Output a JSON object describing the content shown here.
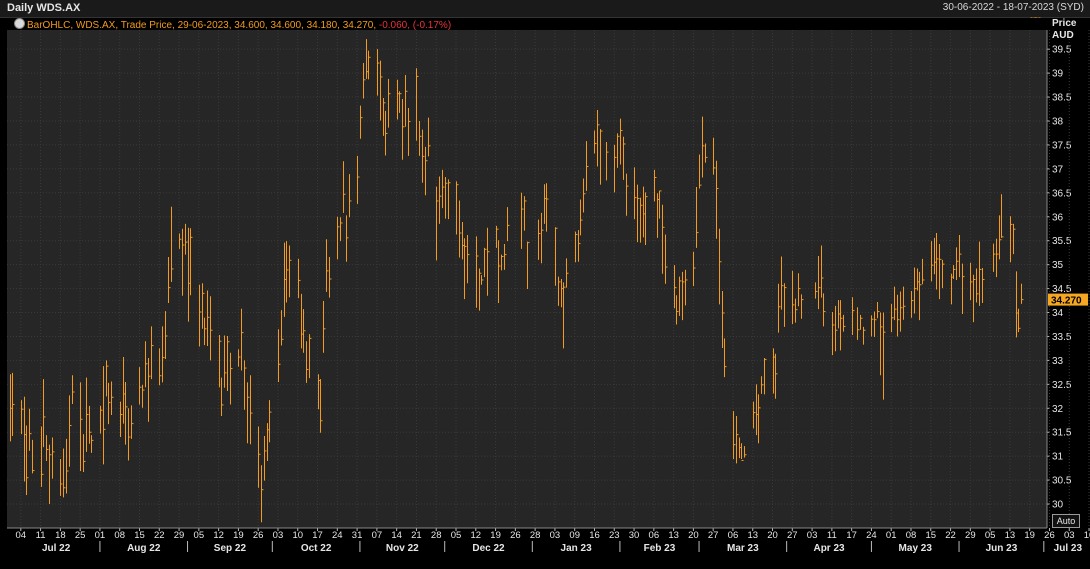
{
  "header": {
    "title": "Daily WDS.AX",
    "date_range": "30-06-2022 - 18-07-2023 (SYD)"
  },
  "legend": {
    "series": "BarOHLC, WDS.AX, Trade Price, 29-06-2023, 34.600, 34.600, 34.180, 34.270,",
    "change": "-0.060, (-0.17%)"
  },
  "axis_header": {
    "line1": "Price",
    "line2": "AUD"
  },
  "auto_button": {
    "label": "Auto"
  },
  "last_price": {
    "label": "34.270",
    "value": 34.27
  },
  "colors": {
    "background": "#262626",
    "bar": "#f29b1f",
    "change_negative": "#e8333a",
    "last_price_tag": "#f5a623"
  },
  "chart_data": {
    "type": "ohlc",
    "ylim": [
      29.5,
      39.9
    ],
    "yticks": [
      30,
      30.5,
      31,
      31.5,
      32,
      32.5,
      33,
      33.5,
      34,
      34.5,
      35,
      35.5,
      36,
      36.5,
      37,
      37.5,
      38,
      38.5,
      39,
      39.5
    ],
    "x_day_labels": [
      "04",
      "11",
      "18",
      "25",
      "01",
      "08",
      "15",
      "22",
      "29",
      "05",
      "12",
      "19",
      "26",
      "03",
      "10",
      "17",
      "24",
      "31",
      "07",
      "14",
      "21",
      "28",
      "05",
      "12",
      "19",
      "26",
      "28",
      "03",
      "09",
      "16",
      "23",
      "30",
      "06",
      "13",
      "20",
      "27",
      "06",
      "13",
      "20",
      "27",
      "03",
      "11",
      "17",
      "24",
      "01",
      "08",
      "15",
      "22",
      "29",
      "05",
      "13",
      "19",
      "26",
      "03",
      "10",
      "17"
    ],
    "x_month_labels": [
      "Jul 22",
      "Aug 22",
      "Sep 22",
      "Oct 22",
      "Nov 22",
      "Dec 22",
      "Jan 23",
      "Feb 23",
      "Mar 23",
      "Apr 23",
      "May 23",
      "Jun 23",
      "Jul 23"
    ],
    "x": [
      "2022-06-30",
      "2022-07-01",
      "2022-07-04",
      "2022-07-05",
      "2022-07-06",
      "2022-07-07",
      "2022-07-08",
      "2022-07-11",
      "2022-07-12",
      "2022-07-13",
      "2022-07-14",
      "2022-07-15",
      "2022-07-18",
      "2022-07-19",
      "2022-07-20",
      "2022-07-21",
      "2022-07-22",
      "2022-07-25",
      "2022-07-26",
      "2022-07-27",
      "2022-07-28",
      "2022-07-29",
      "2022-08-01",
      "2022-08-02",
      "2022-08-03",
      "2022-08-04",
      "2022-08-05",
      "2022-08-08",
      "2022-08-09",
      "2022-08-10",
      "2022-08-11",
      "2022-08-12",
      "2022-08-15",
      "2022-08-16",
      "2022-08-17",
      "2022-08-18",
      "2022-08-19",
      "2022-08-22",
      "2022-08-23",
      "2022-08-24",
      "2022-08-25",
      "2022-08-26",
      "2022-08-29",
      "2022-08-30",
      "2022-08-31",
      "2022-09-01",
      "2022-09-02",
      "2022-09-05",
      "2022-09-06",
      "2022-09-07",
      "2022-09-08",
      "2022-09-09",
      "2022-09-12",
      "2022-09-13",
      "2022-09-14",
      "2022-09-15",
      "2022-09-16",
      "2022-09-19",
      "2022-09-20",
      "2022-09-21",
      "2022-09-22",
      "2022-09-23",
      "2022-09-26",
      "2022-09-27",
      "2022-09-28",
      "2022-09-29",
      "2022-09-30",
      "2022-10-03",
      "2022-10-04",
      "2022-10-05",
      "2022-10-06",
      "2022-10-07",
      "2022-10-10",
      "2022-10-11",
      "2022-10-12",
      "2022-10-13",
      "2022-10-14",
      "2022-10-17",
      "2022-10-18",
      "2022-10-19",
      "2022-10-20",
      "2022-10-21",
      "2022-10-24",
      "2022-10-25",
      "2022-10-26",
      "2022-10-27",
      "2022-10-28",
      "2022-10-31",
      "2022-11-01",
      "2022-11-02",
      "2022-11-03",
      "2022-11-04",
      "2022-11-07",
      "2022-11-08",
      "2022-11-09",
      "2022-11-10",
      "2022-11-11",
      "2022-11-14",
      "2022-11-15",
      "2022-11-16",
      "2022-11-17",
      "2022-11-18",
      "2022-11-21",
      "2022-11-22",
      "2022-11-23",
      "2022-11-24",
      "2022-11-25",
      "2022-11-28",
      "2022-11-29",
      "2022-11-30",
      "2022-12-01",
      "2022-12-02",
      "2022-12-05",
      "2022-12-06",
      "2022-12-07",
      "2022-12-08",
      "2022-12-09",
      "2022-12-12",
      "2022-12-13",
      "2022-12-14",
      "2022-12-15",
      "2022-12-16",
      "2022-12-19",
      "2022-12-20",
      "2022-12-21",
      "2022-12-22",
      "2022-12-23",
      "2022-12-28",
      "2022-12-29",
      "2022-12-30",
      "2023-01-03",
      "2023-01-04",
      "2023-01-05",
      "2023-01-06",
      "2023-01-09",
      "2023-01-10",
      "2023-01-11",
      "2023-01-12",
      "2023-01-13",
      "2023-01-16",
      "2023-01-17",
      "2023-01-18",
      "2023-01-19",
      "2023-01-20",
      "2023-01-23",
      "2023-01-24",
      "2023-01-25",
      "2023-01-27",
      "2023-01-30",
      "2023-01-31",
      "2023-02-01",
      "2023-02-02",
      "2023-02-03",
      "2023-02-06",
      "2023-02-07",
      "2023-02-08",
      "2023-02-09",
      "2023-02-10",
      "2023-02-13",
      "2023-02-14",
      "2023-02-15",
      "2023-02-16",
      "2023-02-17",
      "2023-02-20",
      "2023-02-21",
      "2023-02-22",
      "2023-02-23",
      "2023-02-24",
      "2023-02-27",
      "2023-02-28",
      "2023-03-01",
      "2023-03-02",
      "2023-03-03",
      "2023-03-06",
      "2023-03-07",
      "2023-03-08",
      "2023-03-09",
      "2023-03-10",
      "2023-03-13",
      "2023-03-14",
      "2023-03-15",
      "2023-03-16",
      "2023-03-17",
      "2023-03-20",
      "2023-03-21",
      "2023-03-22",
      "2023-03-23",
      "2023-03-24",
      "2023-03-27",
      "2023-03-28",
      "2023-03-29",
      "2023-03-30",
      "2023-03-31",
      "2023-04-03",
      "2023-04-04",
      "2023-04-05",
      "2023-04-06",
      "2023-04-11",
      "2023-04-12",
      "2023-04-13",
      "2023-04-14",
      "2023-04-17",
      "2023-04-18",
      "2023-04-19",
      "2023-04-20",
      "2023-04-21",
      "2023-04-24",
      "2023-04-26",
      "2023-04-27",
      "2023-04-28",
      "2023-05-01",
      "2023-05-02",
      "2023-05-03",
      "2023-05-04",
      "2023-05-05",
      "2023-05-08",
      "2023-05-09",
      "2023-05-10",
      "2023-05-11",
      "2023-05-12",
      "2023-05-15",
      "2023-05-16",
      "2023-05-17",
      "2023-05-18",
      "2023-05-19",
      "2023-05-22",
      "2023-05-23",
      "2023-05-24",
      "2023-05-25",
      "2023-05-26",
      "2023-05-29",
      "2023-05-30",
      "2023-05-31",
      "2023-06-01",
      "2023-06-02",
      "2023-06-05",
      "2023-06-06",
      "2023-06-07",
      "2023-06-08",
      "2023-06-09",
      "2023-06-13",
      "2023-06-14",
      "2023-06-15",
      "2023-06-16",
      "2023-06-19",
      "2023-06-20",
      "2023-06-21",
      "2023-06-22",
      "2023-06-23",
      "2023-06-26",
      "2023-06-27",
      "2023-06-28",
      "2023-06-29"
    ],
    "close": [
      32.0,
      32.08,
      31.98,
      31.45,
      30.55,
      31.47,
      30.7,
      30.62,
      31.82,
      31.14,
      31.03,
      31.09,
      30.42,
      30.34,
      30.69,
      31.64,
      32.34,
      31.77,
      30.89,
      31.87,
      31.5,
      31.33,
      31.96,
      31.56,
      32.88,
      32.12,
      32.23,
      31.87,
      32.3,
      32.03,
      31.4,
      31.68,
      32.44,
      32.38,
      32.93,
      32.67,
      33.31,
      32.68,
      33.06,
      33.51,
      34.52,
      34.91,
      35.53,
      35.41,
      35.47,
      34.61,
      35.57,
      34.01,
      34.4,
      33.66,
      33.9,
      33.63,
      33.4,
      32.07,
      32.74,
      33.39,
      32.83,
      33.07,
      33.58,
      32.84,
      32.23,
      31.9,
      31.04,
      30.3,
      31.11,
      31.55,
      31.92,
      32.92,
      33.44,
      34.69,
      34.89,
      35.09,
      34.67,
      33.55,
      33.62,
      32.81,
      33.46,
      32.58,
      31.74,
      33.66,
      34.87,
      34.7,
      35.79,
      35.87,
      36.47,
      35.56,
      36.33,
      36.83,
      38.07,
      38.86,
      39.03,
      39.33,
      39.21,
      38.92,
      38.38,
      37.74,
      38.57,
      38.57,
      38.57,
      37.88,
      38.62,
      37.99,
      38.93,
      37.68,
      37.26,
      37.17,
      37.48,
      36.33,
      36.43,
      36.62,
      36.7,
      36.71,
      36.67,
      35.66,
      35.4,
      35.38,
      35.21,
      35.18,
      34.82,
      34.68,
      35.32,
      35.27,
      35.74,
      34.97,
      35.17,
      35.21,
      35.82,
      36.16,
      36.33,
      35.46,
      35.65,
      35.72,
      36.38,
      36.37,
      35.76,
      34.64,
      34.5,
      34.53,
      34.82,
      35.63,
      35.44,
      35.93,
      36.48,
      37.05,
      37.53,
      37.92,
      37.79,
      37.35,
      37.24,
      37.68,
      37.8,
      37.52,
      36.64,
      36.4,
      36.38,
      36.24,
      36.06,
      36.42,
      36.82,
      36.36,
      36.54,
      35.78,
      34.95,
      34.52,
      34.02,
      34.66,
      34.64,
      34.68,
      34.93,
      35.67,
      36.66,
      37.48,
      37.24,
      37.02,
      36.59,
      35.06,
      33.99,
      32.87,
      31.24,
      31.45,
      31.18,
      30.91,
      31.03,
      31.91,
      31.87,
      32.01,
      32.49,
      33.02,
      33.07,
      32.72,
      34.12,
      34.56,
      34.52,
      34.16,
      34.06,
      34.5,
      34.27,
      34.44,
      34.52,
      34.72,
      34.02,
      33.74,
      33.63,
      33.97,
      33.88,
      33.71,
      34.04,
      33.64,
      33.88,
      33.63,
      33.86,
      33.85,
      34.02,
      33.7,
      33.59,
      33.89,
      34.07,
      33.85,
      34.1,
      34.13,
      34.25,
      34.5,
      34.64,
      34.58,
      34.68,
      34.99,
      35.05,
      35.12,
      35.11,
      35.01,
      34.74,
      34.9,
      35.07,
      35.22,
      34.75,
      34.64,
      34.69,
      34.39,
      34.9,
      34.69,
      35.22,
      35.22,
      35.52,
      35.58,
      35.84,
      35.74,
      33.99,
      33.67,
      34.27
    ],
    "high": [
      32.71,
      32.74,
      32.17,
      32.24,
      31.64,
      31.99,
      31.34,
      31.62,
      32.61,
      31.44,
      31.24,
      31.39,
      30.94,
      31.16,
      31.36,
      32.27,
      32.69,
      32.54,
      31.46,
      32.64,
      32.05,
      31.44,
      32.05,
      32.88,
      33.0,
      32.53,
      32.56,
      32.14,
      33.07,
      32.55,
      32.0,
      32.06,
      32.86,
      32.49,
      33.4,
      33.05,
      33.71,
      33.25,
      33.71,
      34.03,
      35.16,
      36.21,
      35.65,
      35.75,
      35.85,
      35.77,
      35.76,
      34.58,
      34.61,
      33.89,
      34.46,
      34.34,
      33.53,
      32.64,
      33.52,
      33.51,
      33.16,
      33.23,
      34.08,
      33.0,
      32.54,
      32.69,
      31.62,
      30.81,
      31.42,
      31.69,
      32.17,
      33.65,
      34.05,
      35.46,
      35.49,
      35.4,
      35.12,
      34.39,
      34.07,
      33.4,
      33.55,
      32.71,
      32.61,
      34.24,
      35.53,
      35.16,
      36.0,
      35.99,
      37.16,
      36.03,
      36.89,
      37.27,
      38.32,
      39.21,
      39.71,
      39.47,
      39.5,
      39.26,
      38.48,
      38.21,
      38.88,
      38.86,
      38.62,
      38.46,
      38.96,
      38.27,
      39.1,
      38.0,
      37.82,
      37.46,
      38.07,
      36.63,
      36.84,
      36.98,
      36.83,
      36.78,
      36.74,
      36.34,
      35.89,
      35.55,
      35.62,
      35.59,
      34.92,
      34.78,
      35.35,
      35.77,
      35.81,
      35.51,
      35.21,
      35.43,
      36.2,
      36.5,
      36.43,
      35.48,
      35.94,
      36.08,
      36.68,
      36.7,
      35.78,
      34.75,
      34.7,
      34.63,
      35.13,
      35.69,
      35.72,
      36.36,
      36.8,
      37.58,
      37.8,
      38.23,
      37.83,
      37.56,
      37.5,
      37.74,
      38.05,
      37.67,
      36.9,
      37.03,
      36.67,
      36.4,
      36.63,
      36.51,
      36.98,
      36.49,
      36.54,
      36.25,
      35.63,
      34.99,
      34.36,
      34.75,
      34.85,
      34.89,
      35.27,
      36.62,
      37.3,
      38.09,
      37.53,
      37.65,
      37.17,
      35.75,
      34.45,
      33.46,
      31.94,
      31.84,
      31.39,
      31.27,
      31.21,
      32.14,
      32.5,
      32.29,
      32.67,
      33.05,
      33.25,
      33.14,
      34.6,
      35.17,
      34.61,
      34.87,
      34.29,
      34.82,
      34.38,
      34.63,
      35.18,
      35.4,
      34.4,
      34.01,
      34.14,
      34.26,
      34.26,
      33.95,
      34.32,
      34.11,
      33.95,
      33.7,
      33.94,
      34.02,
      34.22,
      34.0,
      34.0,
      34.18,
      34.54,
      34.37,
      34.44,
      34.54,
      34.45,
      34.94,
      34.92,
      34.85,
      35.12,
      35.49,
      35.56,
      35.66,
      35.43,
      35.1,
      34.81,
      34.99,
      35.36,
      35.62,
      35.02,
      35.04,
      34.79,
      34.92,
      35.48,
      34.93,
      35.44,
      35.54,
      36.03,
      36.47,
      36.01,
      35.85,
      34.86,
      34.08,
      34.6
    ],
    "low": [
      31.31,
      31.42,
      31.46,
      30.47,
      30.19,
      31.11,
      30.64,
      30.36,
      31.19,
      30.9,
      30.0,
      30.53,
      30.17,
      30.14,
      30.22,
      30.78,
      32.09,
      30.69,
      30.67,
      31.09,
      31.26,
      31.07,
      31.47,
      30.83,
      32.25,
      31.67,
      31.86,
      31.4,
      31.68,
      31.24,
      30.91,
      31.36,
      32.08,
      32.01,
      32.44,
      31.72,
      32.61,
      32.48,
      32.54,
      33.03,
      34.2,
      34.64,
      35.33,
      34.35,
      35.21,
      33.81,
      34.36,
      33.29,
      33.66,
      33.32,
      33.3,
      33.0,
      32.44,
      31.84,
      32.43,
      32.36,
      32.08,
      32.87,
      32.79,
      31.97,
      31.27,
      31.25,
      30.34,
      29.62,
      30.49,
      30.9,
      31.29,
      32.55,
      33.31,
      33.91,
      34.21,
      34.32,
      34.3,
      33.25,
      33.16,
      32.53,
      32.63,
      31.98,
      31.49,
      33.16,
      34.43,
      34.31,
      35.11,
      35.49,
      36.08,
      35.06,
      35.99,
      36.27,
      37.63,
      38.47,
      38.88,
      38.87,
      38.53,
      38.01,
      37.69,
      37.28,
      37.86,
      38.03,
      38.17,
      37.19,
      37.88,
      37.27,
      37.59,
      37.27,
      36.71,
      36.45,
      37.26,
      35.09,
      35.85,
      36.18,
      35.96,
      35.95,
      35.63,
      35.15,
      35.11,
      34.28,
      34.61,
      34.1,
      34.04,
      34.58,
      34.74,
      34.35,
      35.35,
      34.2,
      34.88,
      34.89,
      35.49,
      35.33,
      35.71,
      34.49,
      35.1,
      35.03,
      35.85,
      35.69,
      34.56,
      34.14,
      34.11,
      33.25,
      34.52,
      35.05,
      35.06,
      35.61,
      36.09,
      36.54,
      37.32,
      37.05,
      36.67,
      36.76,
      36.51,
      37.02,
      37.09,
      36.77,
      36.02,
      35.95,
      35.47,
      35.46,
      35.57,
      35.41,
      36.32,
      35.56,
      35.96,
      34.81,
      34.6,
      34.09,
      33.75,
      33.93,
      33.84,
      34.15,
      34.55,
      35.35,
      36.59,
      36.82,
      37.13,
      36.88,
      35.54,
      34.17,
      33.26,
      32.65,
      30.94,
      30.85,
      30.96,
      30.94,
      30.97,
      31.58,
      31.44,
      31.27,
      32.3,
      32.29,
      32.31,
      32.2,
      33.58,
      34.06,
      33.7,
      33.76,
      33.79,
      34.13,
      33.87,
      34.29,
      34.07,
      34.31,
      33.71,
      33.11,
      33.19,
      33.67,
      33.21,
      33.6,
      33.53,
      33.43,
      33.64,
      33.33,
      33.5,
      33.49,
      33.88,
      32.69,
      32.18,
      33.59,
      33.84,
      33.5,
      33.6,
      33.85,
      33.89,
      33.98,
      34.46,
      33.84,
      34.59,
      34.65,
      34.8,
      34.48,
      34.28,
      34.51,
      34.17,
      34.7,
      34.68,
      34.74,
      33.97,
      34.26,
      33.8,
      34.21,
      34.14,
      34.2,
      34.85,
      34.74,
      35.11,
      35.56,
      35.05,
      35.22,
      33.48,
      33.59,
      34.18
    ]
  }
}
